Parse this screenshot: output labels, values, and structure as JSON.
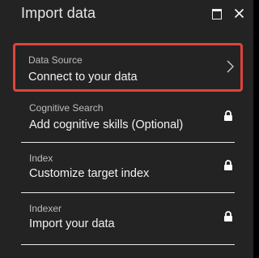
{
  "panel": {
    "title": "Import data",
    "controls": {
      "maximize_icon": "maximize-icon",
      "close_icon": "close-icon"
    }
  },
  "steps": [
    {
      "subtitle": "Data Source",
      "label": "Connect to your data",
      "state": "selected",
      "icon": "chevron-right-icon",
      "accent": "#e0433b"
    },
    {
      "subtitle": "Cognitive Search",
      "label": "Add cognitive skills (Optional)",
      "state": "locked",
      "icon": "lock-icon"
    },
    {
      "subtitle": "Index",
      "label": "Customize target index",
      "state": "locked",
      "icon": "lock-icon"
    },
    {
      "subtitle": "Indexer",
      "label": "Import your data",
      "state": "locked",
      "icon": "lock-icon"
    }
  ]
}
